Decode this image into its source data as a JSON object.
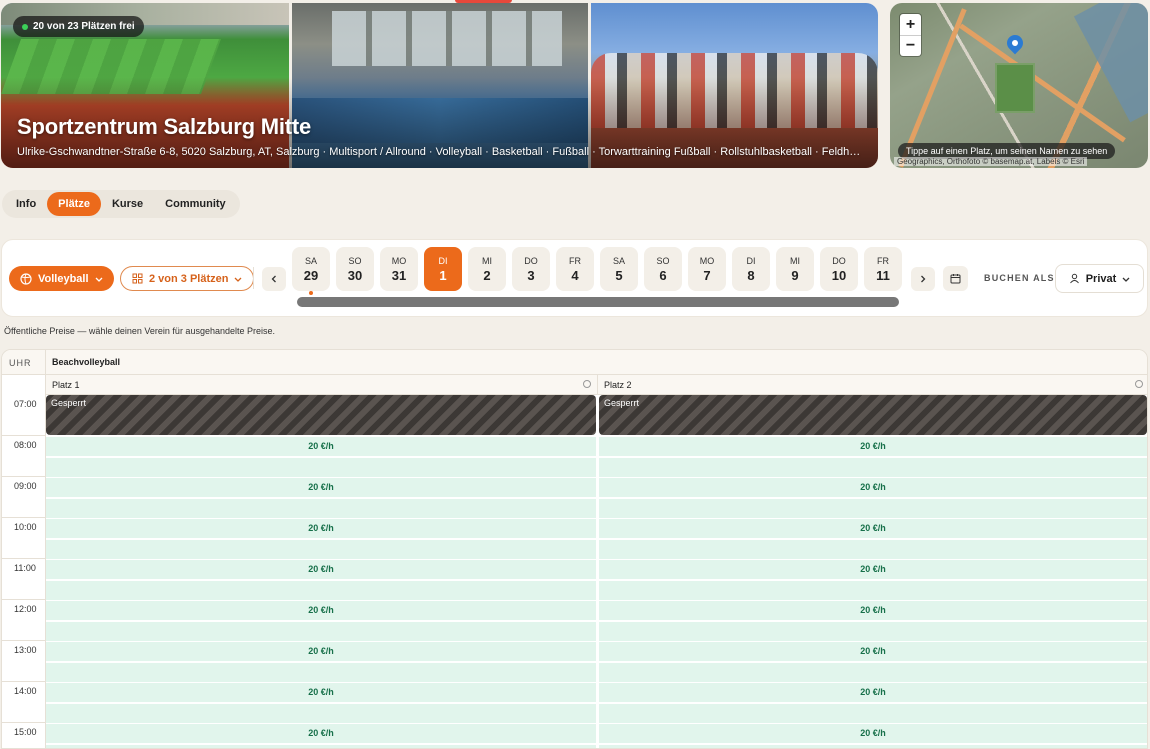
{
  "hero": {
    "availability": "20 von 23 Plätzen frei",
    "title": "Sportzentrum Salzburg Mitte",
    "subtitle": "Ulrike-Gschwandtner-Straße 6-8, 5020 Salzburg, AT, Salzburg · Multisport / Allround · Volleyball · Basketball · Fußball · Torwarttraining Fußball · Rollstuhlbasketball · Feldhockey"
  },
  "map": {
    "zoom_in": "+",
    "zoom_out": "−",
    "tip": "Tippe auf einen Platz, um seinen Namen zu sehen",
    "attribution": "Geographics, Orthofoto © basemap.at, Labels © Esri"
  },
  "tabs": [
    {
      "label": "Info",
      "active": false
    },
    {
      "label": "Plätze",
      "active": true
    },
    {
      "label": "Kurse",
      "active": false
    },
    {
      "label": "Community",
      "active": false
    }
  ],
  "toolbar": {
    "sport_label": "Volleyball",
    "courts_label": "2 von 3 Plätzen",
    "buchen_als": "BUCHEN ALS",
    "privat_label": "Privat",
    "days": [
      {
        "name": "SA",
        "num": "29",
        "active": false,
        "dot": true
      },
      {
        "name": "SO",
        "num": "30",
        "active": false,
        "dot": false
      },
      {
        "name": "MO",
        "num": "31",
        "active": false,
        "dot": false
      },
      {
        "name": "DI",
        "num": "1",
        "active": true,
        "dot": false
      },
      {
        "name": "MI",
        "num": "2",
        "active": false,
        "dot": false
      },
      {
        "name": "DO",
        "num": "3",
        "active": false,
        "dot": false
      },
      {
        "name": "FR",
        "num": "4",
        "active": false,
        "dot": false
      },
      {
        "name": "SA",
        "num": "5",
        "active": false,
        "dot": false
      },
      {
        "name": "SO",
        "num": "6",
        "active": false,
        "dot": false
      },
      {
        "name": "MO",
        "num": "7",
        "active": false,
        "dot": false
      },
      {
        "name": "DI",
        "num": "8",
        "active": false,
        "dot": false
      },
      {
        "name": "MI",
        "num": "9",
        "active": false,
        "dot": false
      },
      {
        "name": "DO",
        "num": "10",
        "active": false,
        "dot": false
      },
      {
        "name": "FR",
        "num": "11",
        "active": false,
        "dot": false
      }
    ]
  },
  "price_note": "Öffentliche Preise — wähle deinen Verein für ausgehandelte Preise.",
  "schedule": {
    "time_header": "UHR",
    "category": "Beachvolleyball",
    "courts": [
      "Platz 1",
      "Platz 2"
    ],
    "blocked_label": "Gesperrt",
    "blocked_time": "07:00",
    "price": "20 €/h",
    "times": [
      "07:00",
      "08:00",
      "09:00",
      "10:00",
      "11:00",
      "12:00",
      "13:00",
      "14:00",
      "15:00"
    ]
  },
  "colors": {
    "accent": "#ec6a1b",
    "slot_bg": "#e1f5ec",
    "price_text": "#17704a"
  }
}
